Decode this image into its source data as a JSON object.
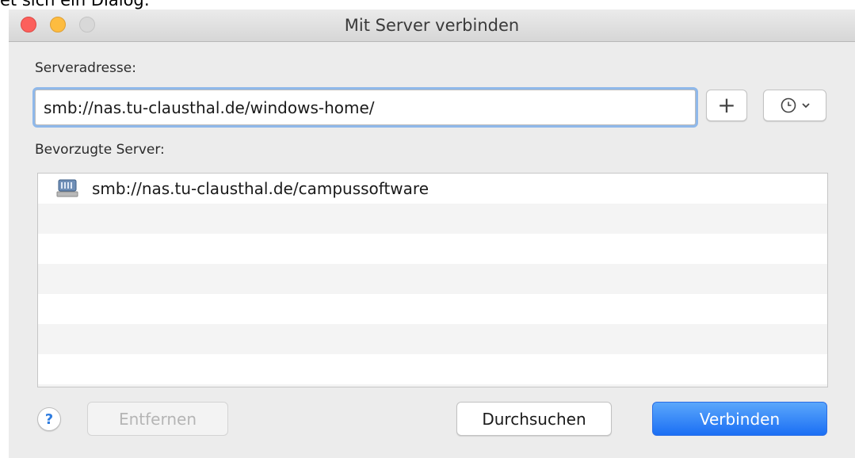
{
  "page_caption": "et sich ein Dialog:",
  "window": {
    "title": "Mit Server verbinden"
  },
  "server_address": {
    "label": "Serveradresse:",
    "value": "smb://nas.tu-clausthal.de/windows-home/"
  },
  "favorites": {
    "label": "Bevorzugte Server:",
    "items": [
      {
        "label": "smb://nas.tu-clausthal.de/campussoftware",
        "icon": "network-server-icon"
      }
    ]
  },
  "buttons": {
    "add": "+",
    "help": "?",
    "remove": "Entfernen",
    "browse": "Durchsuchen",
    "connect": "Verbinden"
  },
  "colors": {
    "accent": "#1b6ff4",
    "focus_ring": "#8fb8ea",
    "close": "#fc605c",
    "minimize": "#fdbc40"
  }
}
